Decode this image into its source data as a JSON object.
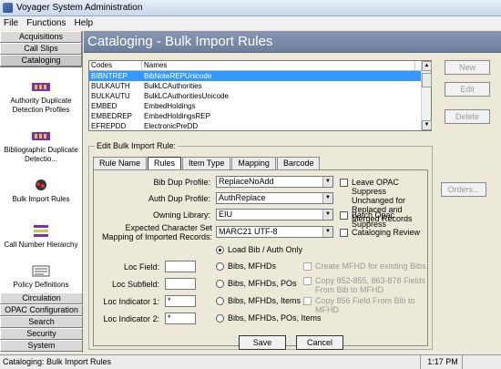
{
  "window": {
    "title": "Voyager System Administration"
  },
  "menu": [
    "File",
    "Functions",
    "Help"
  ],
  "nav_top": [
    "Acquisitions",
    "Call Slips",
    "Cataloging"
  ],
  "nav_items": [
    {
      "label": "Authority Duplicate Detection Profiles"
    },
    {
      "label": "Bibliographic Duplicate Detectio..."
    },
    {
      "label": "Bulk Import Rules"
    },
    {
      "label": "Call Number Hierarchy"
    },
    {
      "label": "Policy Definitions"
    }
  ],
  "nav_bottom": [
    "Circulation",
    "OPAC Configuration",
    "Search",
    "Security",
    "System"
  ],
  "page_title": "Cataloging - Bulk Import Rules",
  "list": {
    "headers": [
      "Codes",
      "Names"
    ],
    "rows": [
      {
        "code": "BIBNTREP",
        "name": "BibNoteREPUnicode",
        "selected": true
      },
      {
        "code": "BULKAUTH",
        "name": "BulkLCAuthorities"
      },
      {
        "code": "BULKAUTU",
        "name": "BulkLCAuthoritiesUnicode"
      },
      {
        "code": "EMBED",
        "name": "EmbedHoldings"
      },
      {
        "code": "EMBEDREP",
        "name": "EmbedHoldingsREP"
      },
      {
        "code": "EFREPDD",
        "name": "ElectronicPreDD"
      }
    ]
  },
  "side_buttons": {
    "new": "New",
    "edit": "Edit",
    "delete": "Delete",
    "orders": "Orders..."
  },
  "edit_group_label": "Edit  Bulk Import Rule:",
  "tabs": [
    "Rule Name",
    "Rules",
    "Item Type",
    "Mapping",
    "Barcode"
  ],
  "fields": {
    "bib_dup_label": "Bib Dup Profile:",
    "bib_dup_value": "ReplaceNoAdd",
    "auth_dup_label": "Auth Dup Profile:",
    "auth_dup_value": "AuthReplace",
    "owning_library_label": "Owning Library:",
    "owning_library_value": "EIU",
    "charset_label": "Expected Character Set Mapping of Imported Records:",
    "charset_value": "MARC21 UTF-8",
    "loc_field_label": "Loc Field:",
    "loc_field_value": "",
    "loc_subfield_label": "Loc Subfield:",
    "loc_subfield_value": "",
    "loc_ind1_label": "Loc Indicator 1:",
    "loc_ind1_value": "*",
    "loc_ind2_label": "Loc Indicator 2:",
    "loc_ind2_value": "*"
  },
  "checks": {
    "leave_opac": "Leave OPAC Suppress Unchanged for Replaced and Merged Records",
    "batch_opac": "Batch Opac Suppress",
    "cataloging_review": "Cataloging Review",
    "create_mfhd": "Create MFHD for existing Bibs",
    "copy_852": "Copy 852-855, 863-878 Fields From Bib to MFHD",
    "copy_856": "Copy 856 Field From Bib to MFHD"
  },
  "radios": [
    {
      "label": "Load Bib / Auth Only",
      "checked": true
    },
    {
      "label": "Bibs, MFHDs"
    },
    {
      "label": "Bibs, MFHDs, POs"
    },
    {
      "label": "Bibs, MFHDs, Items"
    },
    {
      "label": "Bibs, MFHDs, POs, Items"
    }
  ],
  "actions": {
    "save": "Save",
    "cancel": "Cancel"
  },
  "status": {
    "text": "Cataloging:  Bulk Import Rules",
    "time": "1:17 PM"
  }
}
